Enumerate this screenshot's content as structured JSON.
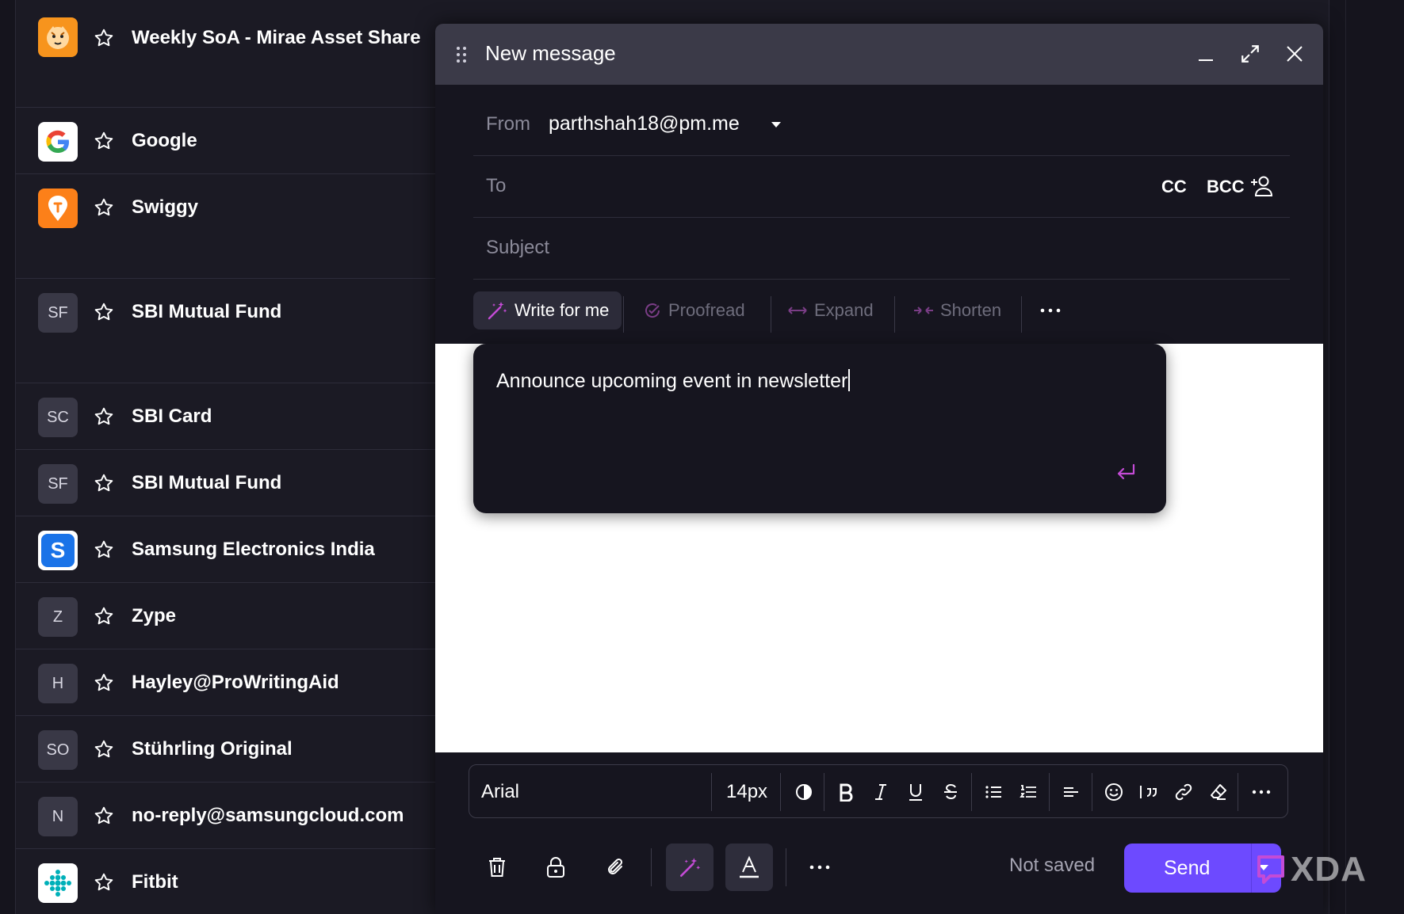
{
  "inbox": {
    "items": [
      {
        "sender": "Weekly SoA - Mirae Asset Share",
        "avatar": "logo",
        "icon": "tiger-logo-icon"
      },
      {
        "sender": "Google",
        "avatar": "logo",
        "icon": "google-logo-icon"
      },
      {
        "sender": "Swiggy",
        "avatar": "logo",
        "icon": "swiggy-logo-icon"
      },
      {
        "sender": "SBI Mutual Fund",
        "avatar": "SF"
      },
      {
        "sender": "SBI Card",
        "avatar": "SC"
      },
      {
        "sender": "SBI Mutual Fund",
        "avatar": "SF"
      },
      {
        "sender": "Samsung Electronics India",
        "avatar": "logo",
        "icon": "samsung-logo-icon"
      },
      {
        "sender": "Zype",
        "avatar": "Z"
      },
      {
        "sender": "Hayley@ProWritingAid",
        "avatar": "H"
      },
      {
        "sender": "Stührling Original",
        "avatar": "SO"
      },
      {
        "sender": "no-reply@samsungcloud.com",
        "avatar": "N"
      },
      {
        "sender": "Fitbit",
        "avatar": "logo",
        "icon": "fitbit-logo-icon"
      }
    ]
  },
  "composer": {
    "title": "New message",
    "from_label": "From",
    "from_value": "parthshah18@pm.me",
    "to_label": "To",
    "cc_label": "CC",
    "bcc_label": "BCC",
    "subject_label": "Subject",
    "ai_actions": {
      "write": "Write for me",
      "proofread": "Proofread",
      "expand": "Expand",
      "shorten": "Shorten"
    },
    "ai_prompt": "Announce upcoming event in newsletter",
    "format": {
      "font": "Arial",
      "size": "14px"
    },
    "status": "Not saved",
    "send_label": "Send"
  },
  "watermark": "XDA",
  "colors": {
    "accent": "#6d4aff",
    "magic": "#c44bd6",
    "bg": "#1b1a24",
    "header": "#3b3a48"
  }
}
